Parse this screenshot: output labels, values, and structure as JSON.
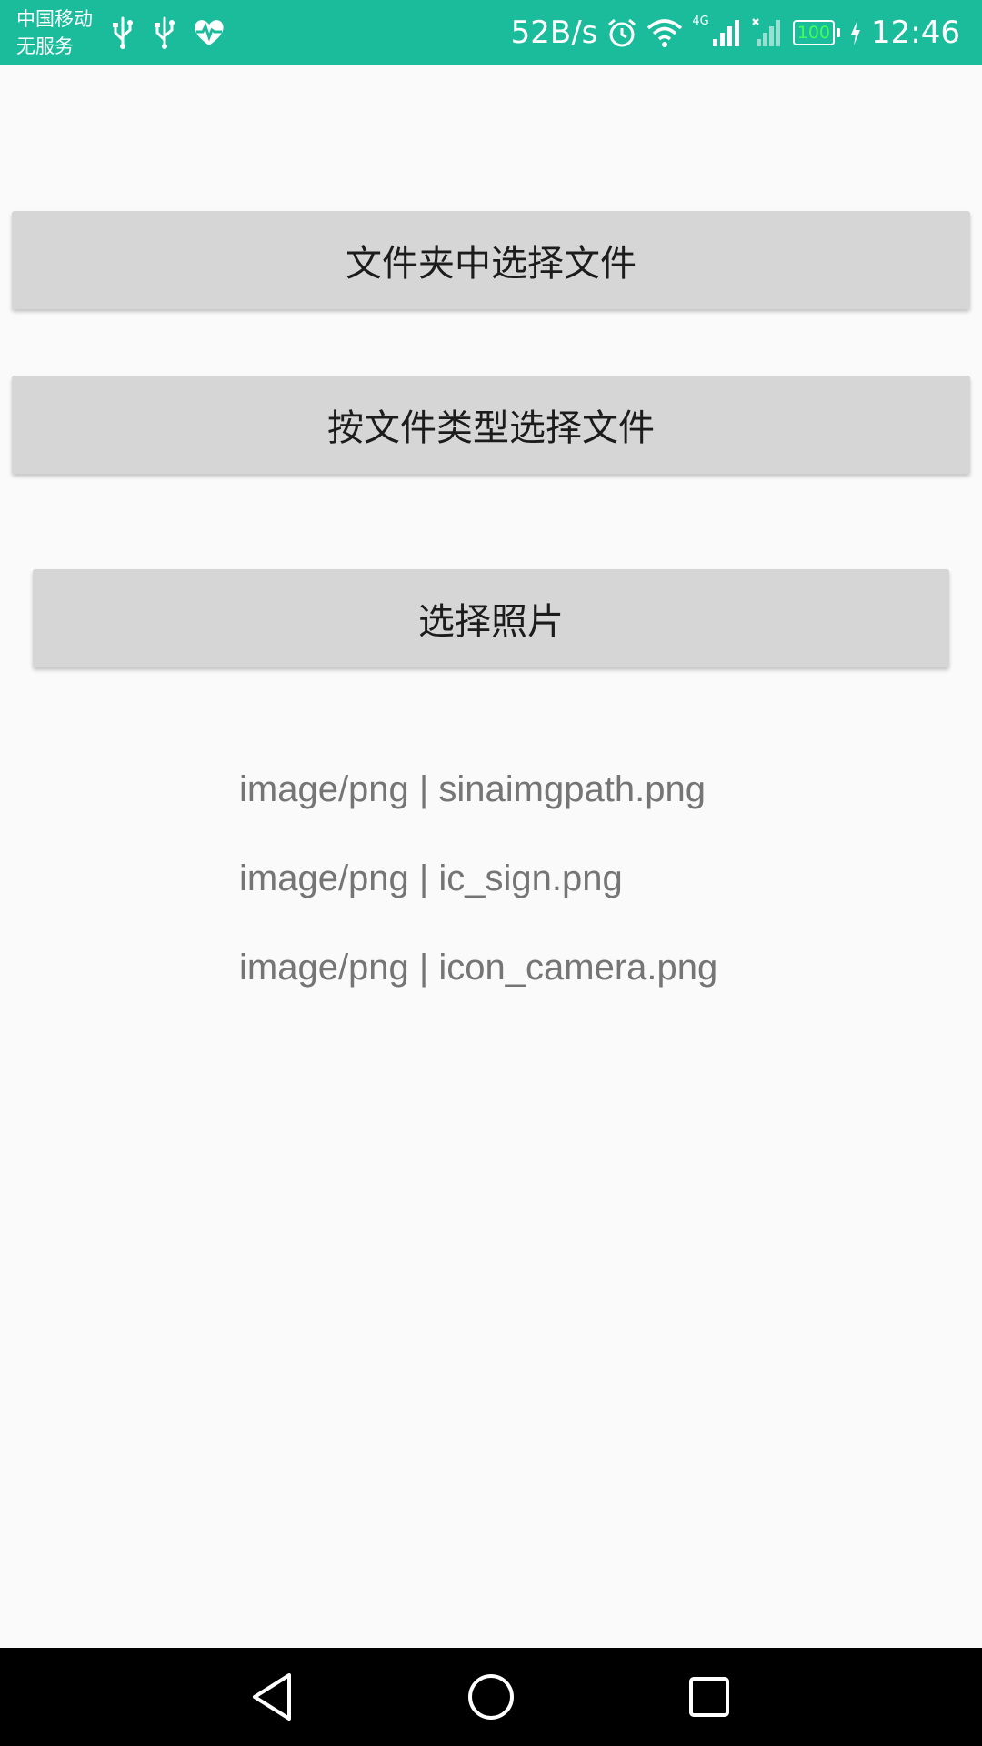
{
  "status_bar": {
    "carrier_line1": "中国移动",
    "carrier_line2": "无服务",
    "net_speed": "52B/s",
    "network_type": "4G",
    "battery_level": "100",
    "time": "12:46",
    "icons": [
      "usb-icon",
      "usb-icon",
      "health-heart-icon",
      "alarm-icon",
      "wifi-icon",
      "signal-icon",
      "no-signal-icon",
      "battery-icon",
      "charging-icon"
    ]
  },
  "buttons": {
    "pick_from_folder": "文件夹中选择文件",
    "pick_by_type": "按文件类型选择文件",
    "pick_photo": "选择照片"
  },
  "results": [
    "image/png | sinaimgpath.png",
    "image/png | ic_sign.png",
    "image/png | icon_camera.png"
  ],
  "nav_bar": {
    "icons": [
      "back-icon",
      "home-icon",
      "recent-apps-icon"
    ]
  },
  "colors": {
    "status_bar": "#1abc9c",
    "background": "#fafafa",
    "button": "#d6d6d6",
    "button_text": "#1c1c1c",
    "result_text": "#757575",
    "nav_bar": "#000000"
  }
}
